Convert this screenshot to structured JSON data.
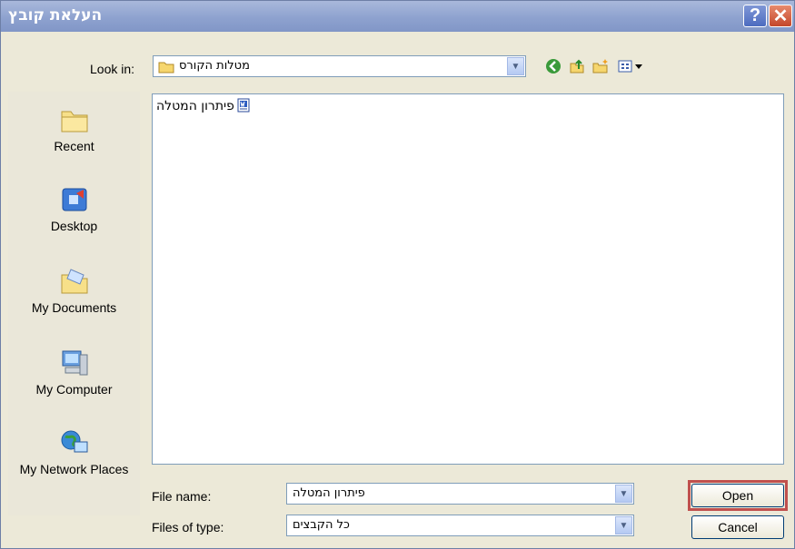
{
  "window": {
    "title": "העלאת קובץ"
  },
  "look_in": {
    "label": "Look in:",
    "value": "מטלות הקורס"
  },
  "toolbar": {
    "icons": [
      "back-icon",
      "up-folder-icon",
      "new-folder-icon",
      "views-menu-icon"
    ]
  },
  "places": [
    {
      "label": "Recent",
      "icon": "recent-folder-icon"
    },
    {
      "label": "Desktop",
      "icon": "desktop-icon"
    },
    {
      "label": "My Documents",
      "icon": "my-documents-icon"
    },
    {
      "label": "My Computer",
      "icon": "my-computer-icon"
    },
    {
      "label": "My Network Places",
      "icon": "network-places-icon"
    }
  ],
  "files": [
    {
      "name": "פיתרון המטלה",
      "icon": "word-document-icon"
    }
  ],
  "file_name": {
    "label": "File name:",
    "value": "פיתרון המטלה"
  },
  "file_type": {
    "label": "Files of type:",
    "value": "כל הקבצים"
  },
  "buttons": {
    "open": "Open",
    "cancel": "Cancel"
  },
  "colors": {
    "title_bar": "#8ea2cf",
    "highlight": "#c0504d",
    "dialog_bg": "#ece9d8"
  }
}
